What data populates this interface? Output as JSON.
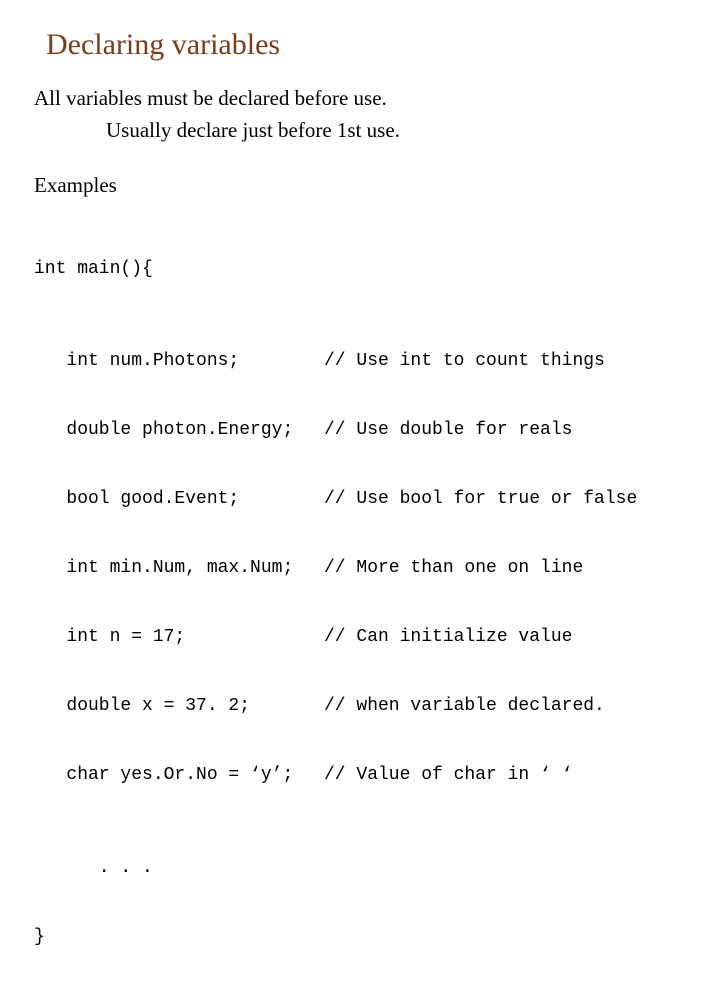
{
  "title": "Declaring variables",
  "line1": "All variables must be declared before use.",
  "line2": "Usually declare just before 1st use.",
  "examples_heading": "Examples",
  "code": {
    "open": "int main(){",
    "rows": [
      {
        "l": "   int num.Photons;",
        "r": "// Use int to count things"
      },
      {
        "l": "   double photon.Energy;",
        "r": "// Use double for reals"
      },
      {
        "l": "   bool good.Event;",
        "r": "// Use bool for true or false"
      },
      {
        "l": "   int min.Num, max.Num;",
        "r": "// More than one on line"
      },
      {
        "l": "   int n = 17;",
        "r": "// Can initialize value"
      },
      {
        "l": "   double x = 37. 2;",
        "r": "// when variable declared."
      },
      {
        "l": "   char yes.Or.No = ‘y’;",
        "r": "// Value of char in ‘ ‘"
      }
    ],
    "dots": "      . . .",
    "close": "}"
  }
}
